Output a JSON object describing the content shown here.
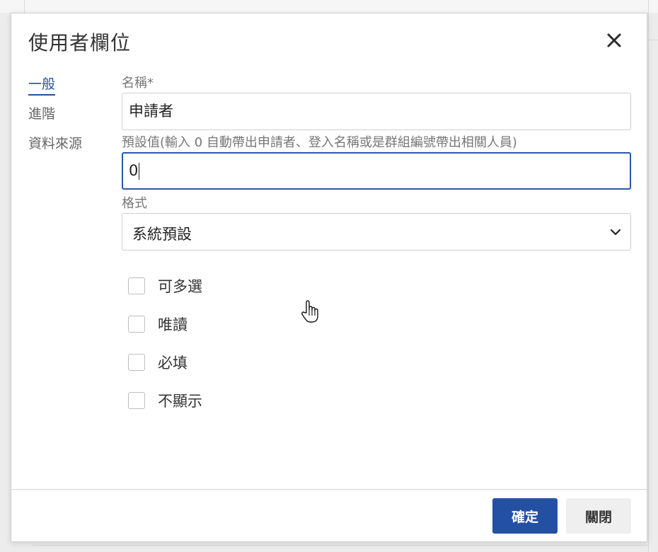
{
  "dialog": {
    "title": "使用者欄位",
    "close_icon": "close-icon"
  },
  "nav": {
    "items": [
      {
        "label": "一般",
        "active": true
      },
      {
        "label": "進階",
        "active": false
      },
      {
        "label": "資料來源",
        "active": false
      }
    ]
  },
  "form": {
    "name_label": "名稱*",
    "name_value": "申請者",
    "default_label": "預設值(輸入 0 自動帶出申請者、登入名稱或是群組編號帶出相關人員)",
    "default_value": "0",
    "format_label": "格式",
    "format_value": "系統預設",
    "checkboxes": [
      {
        "label": "可多選",
        "checked": false
      },
      {
        "label": "唯讀",
        "checked": false
      },
      {
        "label": "必填",
        "checked": false
      },
      {
        "label": "不顯示",
        "checked": false
      }
    ]
  },
  "footer": {
    "ok_label": "確定",
    "close_label": "關閉"
  },
  "colors": {
    "accent": "#2450a4",
    "focus_border": "#2a56b0"
  }
}
